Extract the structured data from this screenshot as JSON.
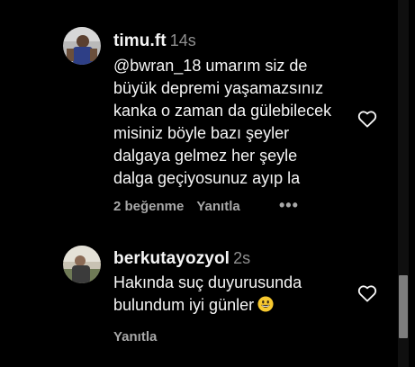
{
  "comments": [
    {
      "username": "timu.ft",
      "time": "14s",
      "text": "@bwran_18 umarım siz de\nbüyük depremi yaşamazsınız\nkanka o zaman da gülebilecek\nmisiniz böyle bazı şeyler\ndalgaya gelmez her şeyle\ndalga geçiyosunuz ayıp la",
      "likes": "2 beğenme",
      "reply": "Yanıtla",
      "more": "•••",
      "avatar_icon": "user-avatar-photo",
      "like_icon": "heart-outline-icon"
    },
    {
      "username": "berkutayozyol",
      "time": "2s",
      "text": "Hakında suç duyurusunda\nbulundum iyi günler",
      "emoji": "grinning-face-emoji",
      "reply": "Yanıtla",
      "avatar_icon": "user-avatar-photo",
      "like_icon": "heart-outline-icon"
    }
  ],
  "colors": {
    "background": "#000000",
    "primary_text": "#f5f5f5",
    "secondary_text": "#a8a8a8",
    "scroll_thumb": "#7d7d7d"
  }
}
